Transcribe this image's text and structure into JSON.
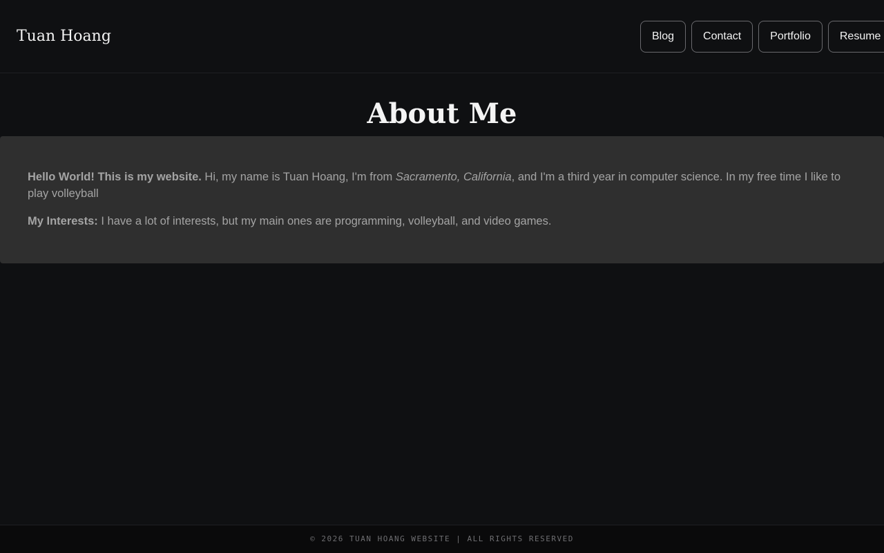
{
  "header": {
    "site_title": "Tuan Hoang",
    "nav": [
      {
        "label": "Blog"
      },
      {
        "label": "Contact"
      },
      {
        "label": "Portfolio"
      },
      {
        "label": "Resume"
      }
    ]
  },
  "main": {
    "title": "About Me",
    "intro": {
      "lead": "Hello World! This is my website.",
      "text_before": " Hi, my name is Tuan Hoang, I'm from ",
      "location": "Sacramento, California",
      "text_after": ", and I'm a third year in computer science. In my free time I like to play volleyball"
    },
    "interests": {
      "label": "My Interests:",
      "text": " I have a lot of interests, but my main ones are programming, volleyball, and video games."
    }
  },
  "footer": {
    "copyright": "© 2026 TUAN HOANG WEBSITE | ALL RIGHTS RESERVED"
  },
  "colors": {
    "background": "#0f1012",
    "card": "#2f2f2f",
    "heading": "#f4f4f4",
    "body_text": "#a4a4a4",
    "button_border": "#6a6a6e"
  }
}
